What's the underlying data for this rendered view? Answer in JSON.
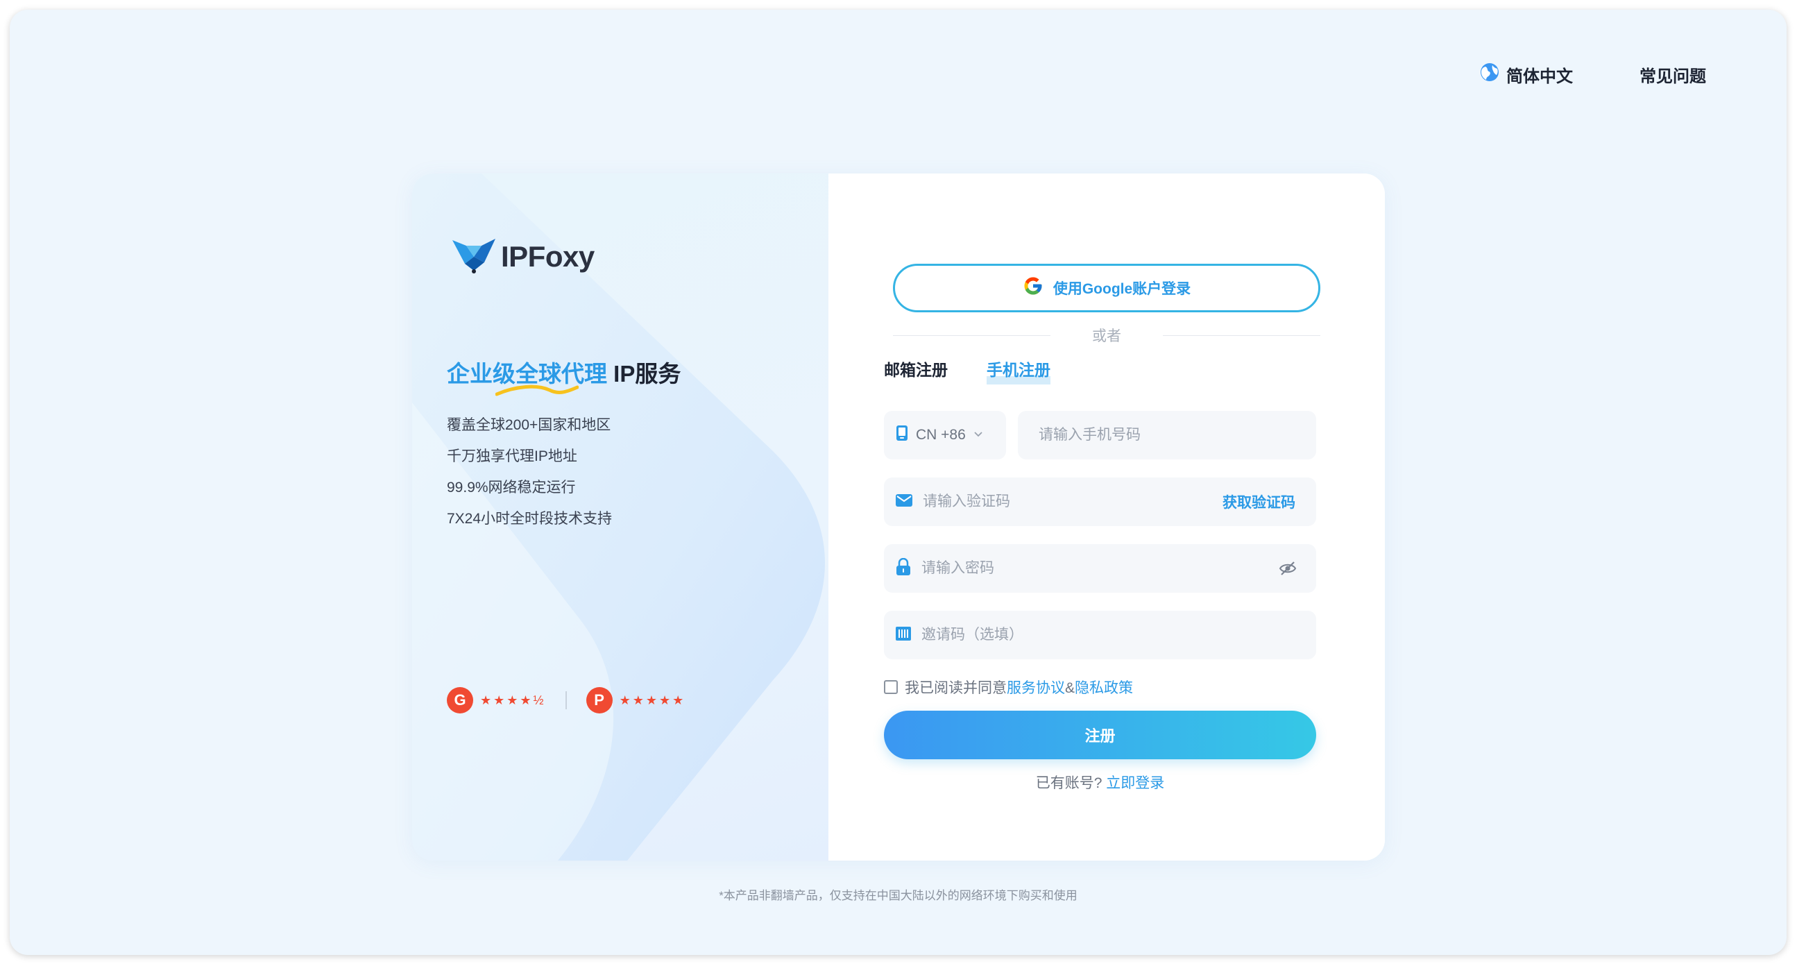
{
  "header": {
    "language_label": "简体中文",
    "faq_label": "常见问题"
  },
  "brand": {
    "name": "IPFoxy"
  },
  "hero": {
    "headline_highlight": "企业级全球代理",
    "headline_rest": " IP服务",
    "features": [
      "覆盖全球200+国家和地区",
      "千万独享代理IP地址",
      "99.9%网络稳定运行",
      "7X24小时全时段技术支持"
    ],
    "ratings": [
      {
        "badge": "G",
        "stars": "★★★★½"
      },
      {
        "badge": "P",
        "stars": "★★★★★"
      }
    ]
  },
  "form": {
    "google_button_label": "使用Google账户登录",
    "or_text": "或者",
    "tabs": [
      {
        "label": "邮箱注册",
        "active": false
      },
      {
        "label": "手机注册",
        "active": true
      }
    ],
    "country_code": "CN +86",
    "phone_placeholder": "请输入手机号码",
    "code_placeholder": "请输入验证码",
    "get_code_label": "获取验证码",
    "password_placeholder": "请输入密码",
    "invite_placeholder": "邀请码（选填）",
    "agree_text": "我已阅读并同意",
    "terms_link": "服务协议",
    "amp": "&",
    "privacy_link": "隐私政策",
    "submit_label": "注册",
    "have_account_text": "已有账号?",
    "login_link": "立即登录"
  },
  "footer": {
    "note": "*本产品非翻墙产品，仅支持在中国大陆以外的网络环境下购买和使用"
  },
  "colors": {
    "accent": "#2b9ae6",
    "rating_red": "#f04a32",
    "button_gradient_start": "#3b97f2",
    "button_gradient_end": "#36c8e6"
  }
}
